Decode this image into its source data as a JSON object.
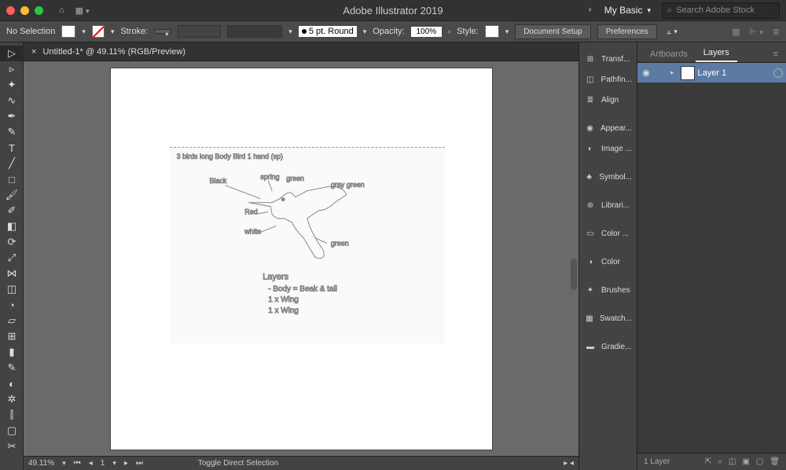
{
  "titlebar": {
    "app_title": "Adobe Illustrator 2019",
    "workspace": "My Basic",
    "search_placeholder": "Search Adobe Stock"
  },
  "control": {
    "selection": "No Selection",
    "stroke_label": "Stroke:",
    "pt_value": "5 pt. Round",
    "opacity_label": "Opacity:",
    "opacity_value": "100%",
    "style_label": "Style:",
    "doc_setup": "Document Setup",
    "preferences": "Preferences"
  },
  "document": {
    "tab_title": "Untitled-1* @ 49.11% (RGB/Preview)"
  },
  "status": {
    "zoom": "49.11%",
    "page": "1",
    "hint": "Toggle Direct Selection"
  },
  "panels": {
    "items": [
      {
        "label": "Transf...",
        "icon": "⊞"
      },
      {
        "label": "Pathfin...",
        "icon": "◫"
      },
      {
        "label": "Align",
        "icon": "≣"
      },
      {
        "label": "Appear...",
        "icon": "◉"
      },
      {
        "label": "Image ...",
        "icon": "◐"
      },
      {
        "label": "Symbol...",
        "icon": "♣"
      },
      {
        "label": "Librari...",
        "icon": "⊚"
      },
      {
        "label": "Color ...",
        "icon": "▭"
      },
      {
        "label": "Color",
        "icon": "◑"
      },
      {
        "label": "Brushes",
        "icon": "✦"
      },
      {
        "label": "Swatch...",
        "icon": "▦"
      },
      {
        "label": "Gradie...",
        "icon": "▬"
      }
    ]
  },
  "layers_panel": {
    "tab_artboards": "Artboards",
    "tab_layers": "Layers",
    "layer_name": "Layer 1",
    "footer": "1 Layer"
  },
  "sketch": {
    "title_text": "3 birds long Body   Bird 1 hand (sp)",
    "labels": [
      "Black",
      "spring",
      "green",
      "gray green",
      "Red",
      "white",
      "green"
    ],
    "notes_heading": "Layers",
    "notes": [
      "- Body = Beak & tail",
      "1 x Wing",
      "1 x Wing"
    ]
  }
}
